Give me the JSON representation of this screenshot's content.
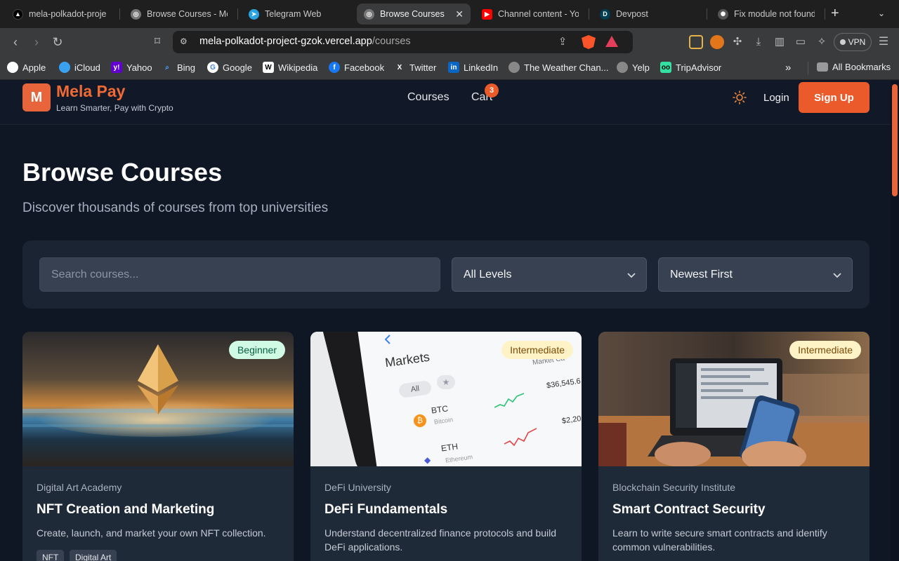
{
  "browser": {
    "tabs": [
      {
        "label": "mela-polkadot-proje",
        "icon": "vercel-icon"
      },
      {
        "label": "Browse Courses - Me",
        "icon": "globe-icon"
      },
      {
        "label": "Telegram Web",
        "icon": "telegram-icon"
      },
      {
        "label": "Browse Courses",
        "icon": "globe-icon"
      },
      {
        "label": "Channel content - Yo",
        "icon": "youtube-icon"
      },
      {
        "label": "Devpost",
        "icon": "devpost-icon"
      },
      {
        "label": "Fix module not found",
        "icon": "chatgpt-icon"
      }
    ],
    "address": {
      "domain": "mela-polkadot-project-gzok.vercel.app",
      "path": "/courses"
    },
    "vpn_label": "VPN",
    "bookmarks": [
      {
        "label": "Apple",
        "icon": "apple-icon"
      },
      {
        "label": "iCloud",
        "icon": "icloud-icon"
      },
      {
        "label": "Yahoo",
        "icon": "yahoo-icon"
      },
      {
        "label": "Bing",
        "icon": "bing-icon"
      },
      {
        "label": "Google",
        "icon": "google-icon"
      },
      {
        "label": "Wikipedia",
        "icon": "wikipedia-icon"
      },
      {
        "label": "Facebook",
        "icon": "facebook-icon"
      },
      {
        "label": "Twitter",
        "icon": "twitter-icon"
      },
      {
        "label": "LinkedIn",
        "icon": "linkedin-icon"
      },
      {
        "label": "The Weather Chan...",
        "icon": "globe-icon"
      },
      {
        "label": "Yelp",
        "icon": "globe-icon"
      },
      {
        "label": "TripAdvisor",
        "icon": "tripadvisor-icon"
      }
    ],
    "all_bookmarks": "All Bookmarks",
    "chevron_more": "»"
  },
  "site": {
    "logo_letter": "M",
    "brand": "Mela Pay",
    "tagline": "Learn Smarter, Pay with Crypto",
    "nav": {
      "courses": "Courses",
      "cart": "Cart",
      "cart_count": "3"
    },
    "login": "Login",
    "signup": "Sign Up",
    "accent": "#ea5a2a"
  },
  "main": {
    "title": "Browse Courses",
    "subtitle": "Discover thousands of courses from top universities",
    "search_placeholder": "Search courses...",
    "level_filter": "All Levels",
    "sort": "Newest First"
  },
  "courses": [
    {
      "level": "Beginner",
      "provider": "Digital Art Academy",
      "title": "NFT Creation and Marketing",
      "description": "Create, launch, and market your own NFT collection.",
      "tags": [
        "NFT",
        "Digital Art"
      ]
    },
    {
      "level": "Intermediate",
      "provider": "DeFi University",
      "title": "DeFi Fundamentals",
      "description": "Understand decentralized finance protocols and build DeFi applications.",
      "tags": []
    },
    {
      "level": "Intermediate",
      "provider": "Blockchain Security Institute",
      "title": "Smart Contract Security",
      "description": "Learn to write secure smart contracts and identify common vulnerabilities.",
      "tags": []
    }
  ],
  "phone_screen": {
    "heading": "Markets",
    "all": "All",
    "rows": [
      {
        "symbol": "BTC",
        "name": "Bitcoin",
        "price": "$36,545.6"
      },
      {
        "symbol": "ETH",
        "name": "Ethereum",
        "price": "$2,20"
      }
    ],
    "col_header": "Market Ca"
  }
}
